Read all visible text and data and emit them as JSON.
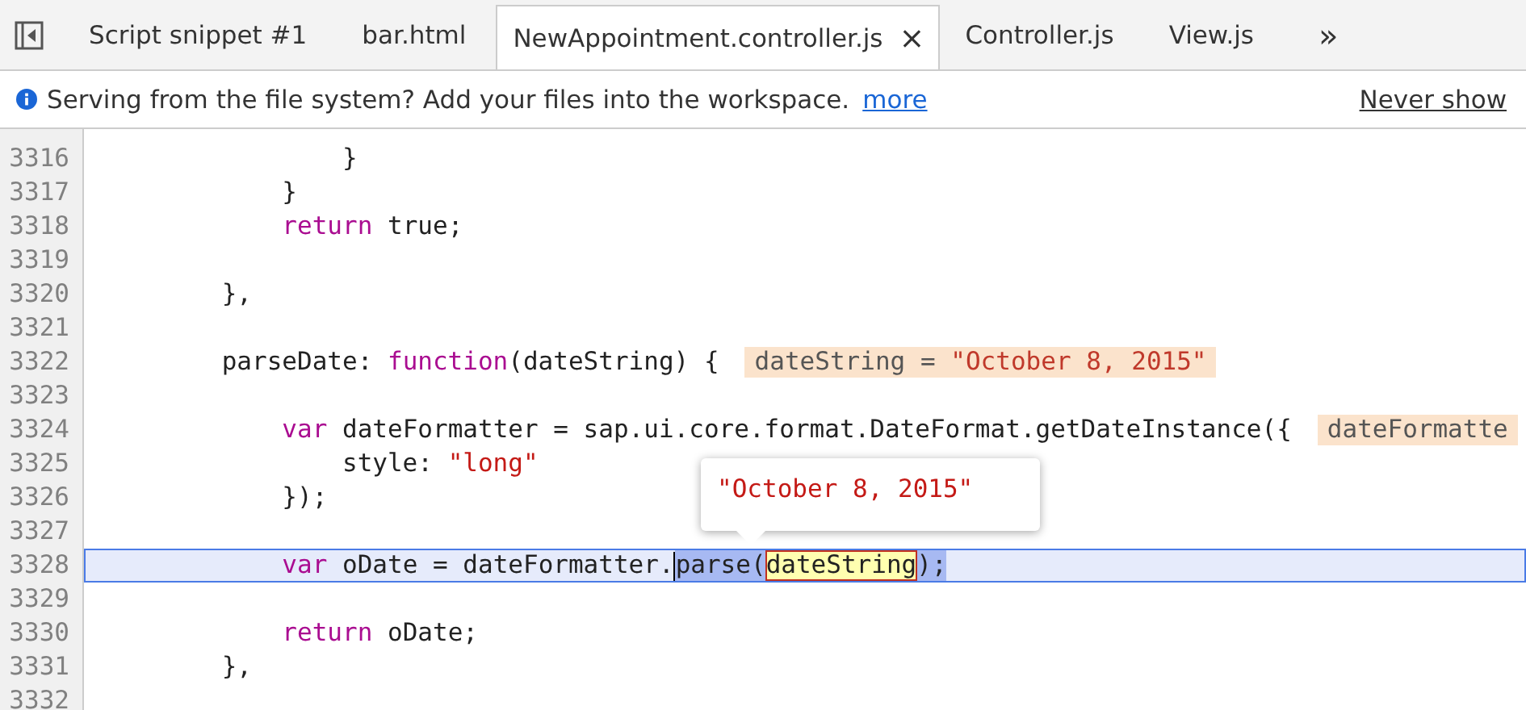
{
  "tabs": [
    {
      "label": "Script snippet #1",
      "selected": false,
      "closable": false
    },
    {
      "label": "bar.html",
      "selected": false,
      "closable": false
    },
    {
      "label": "NewAppointment.controller.js",
      "selected": true,
      "closable": true
    },
    {
      "label": "Controller.js",
      "selected": false,
      "closable": false
    },
    {
      "label": "View.js",
      "selected": false,
      "closable": false
    }
  ],
  "more_tabs": "»",
  "close_glyph": "×",
  "infobar": {
    "message": "Serving from the file system? Add your files into the workspace.",
    "link": "more",
    "dismiss": "Never show"
  },
  "lines": [
    {
      "number": "3316",
      "current": false,
      "tokens": [
        {
          "text": "            }",
          "kind": "plain"
        }
      ]
    },
    {
      "number": "3317",
      "current": false,
      "tokens": [
        {
          "text": "        }",
          "kind": "plain"
        }
      ]
    },
    {
      "number": "3318",
      "current": false,
      "tokens": [
        {
          "text": "        return",
          "kind": "keyword"
        },
        {
          "text": " true;",
          "kind": "plain"
        }
      ]
    },
    {
      "number": "3319",
      "current": false
    },
    {
      "number": "3320",
      "current": false,
      "tokens": [
        {
          "text": "    },",
          "kind": "plain"
        }
      ]
    },
    {
      "number": "3321",
      "current": false
    },
    {
      "number": "3322",
      "current": false,
      "tokens": [
        {
          "text": "    parseDate: ",
          "kind": "plain"
        },
        {
          "text": "function",
          "kind": "keyword"
        },
        {
          "text": "(dateString) {",
          "kind": "plain"
        }
      ],
      "inline_value": {
        "name": "dateString = ",
        "value": "\"October 8, 2015\""
      }
    },
    {
      "number": "3323",
      "current": false
    },
    {
      "number": "3324",
      "current": false,
      "tokens": [
        {
          "text": "        var",
          "kind": "keyword"
        },
        {
          "text": " dateFormatter = sap.ui.core.format.DateFormat.getDateInstance({",
          "kind": "plain"
        }
      ],
      "inline_value": {
        "name": "dateFormatte"
      }
    },
    {
      "number": "3325",
      "current": false,
      "tokens": [
        {
          "text": "            style: ",
          "kind": "plain"
        },
        {
          "text": "\"long\"",
          "kind": "string"
        }
      ]
    },
    {
      "number": "3326",
      "current": false,
      "tokens": [
        {
          "text": "        });",
          "kind": "plain"
        }
      ]
    },
    {
      "number": "3327",
      "current": false
    },
    {
      "number": "3328",
      "current": true,
      "tokens": [
        {
          "text": "        var",
          "kind": "keyword"
        },
        {
          "text": " oDate = dateFormatter.",
          "kind": "plain"
        },
        {
          "text": "parse(",
          "kind": "selected"
        },
        {
          "text": "dateString",
          "kind": "hovered"
        },
        {
          "text": ");",
          "kind": "selected"
        }
      ]
    },
    {
      "number": "3329",
      "current": false
    },
    {
      "number": "3330",
      "current": false,
      "tokens": [
        {
          "text": "        return",
          "kind": "keyword"
        },
        {
          "text": " oDate;",
          "kind": "plain"
        }
      ]
    },
    {
      "number": "3331",
      "current": false,
      "tokens": [
        {
          "text": "    },",
          "kind": "plain"
        }
      ]
    },
    {
      "number": "3332",
      "current": false
    }
  ],
  "tooltip": {
    "value": "\"October 8, 2015\""
  }
}
